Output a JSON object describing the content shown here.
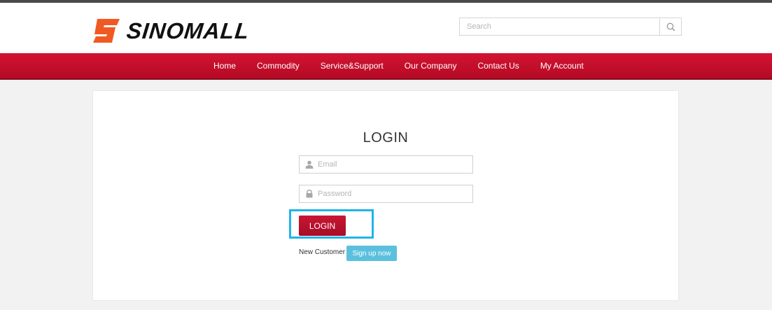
{
  "brand": {
    "name": "SINOMALL",
    "mark_color": "#f05a22"
  },
  "search": {
    "placeholder": "Search",
    "icon": "search-icon"
  },
  "nav": {
    "items": [
      "Home",
      "Commodity",
      "Service&Support",
      "Our Company",
      "Contact Us",
      "My Account"
    ],
    "color": "#c8102e"
  },
  "login": {
    "title": "LOGIN",
    "email_placeholder": "Email",
    "email_icon": "user-icon",
    "password_placeholder": "Password",
    "password_icon": "lock-icon",
    "submit_label": "LOGIN",
    "new_customer_label": "New Customer",
    "signup_label": "Sign up now"
  },
  "colors": {
    "highlight": "#1fb5e8",
    "signup": "#5bc0de",
    "login_button": "#b50f2c"
  }
}
